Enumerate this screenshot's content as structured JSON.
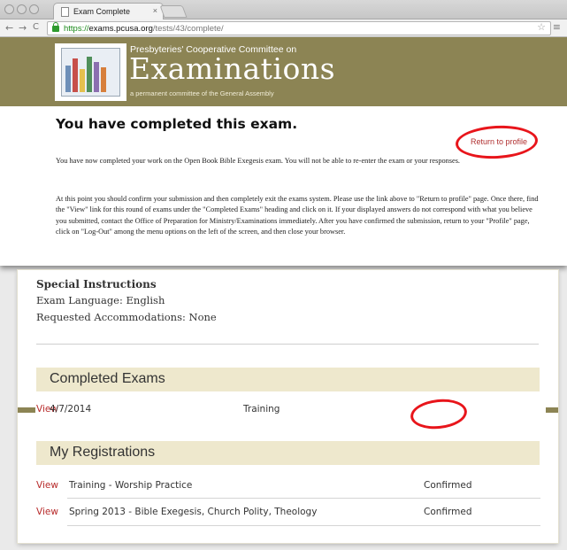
{
  "browser": {
    "tab_title": "Exam Complete",
    "tab_close": "×",
    "url_scheme": "https://",
    "url_domain": "exams.pcusa.org",
    "url_path": "/tests/43/complete/"
  },
  "banner": {
    "subtitle": "Presbyteries' Cooperative Committee on",
    "title": "Examinations",
    "tagline": "a permanent committee of the General Assembly"
  },
  "page": {
    "heading": "You have completed this exam.",
    "return_link": "Return to profile",
    "paragraph_1": "You have now completed your work on the Open Book Bible Exegesis exam. You will not be able to re-enter the exam or your responses.",
    "paragraph_2": "At this point you should confirm your submission and then completely exit the exams system. Please use the link above to \"Return to profile\" page. Once there, find the \"View\" link for this round of exams under the \"Completed Exams\" heading and click on it. If your displayed answers do not correspond with what you believe you submitted, contact the Office of Preparation for Ministry/Examinations immediately. After you have confirmed the submission, return to your \"Profile\" page, click on \"Log-Out\" among the menu options on the left of the screen, and then close your browser."
  },
  "profile": {
    "special_instructions": "Special Instructions",
    "exam_language": "Exam Language: English",
    "accommodations": "Requested Accommodations: None",
    "completed_heading": "Completed Exams",
    "completed": [
      {
        "date": "4/7/2014",
        "name": "Training",
        "action": "View"
      }
    ],
    "registrations_heading": "My Registrations",
    "registrations": [
      {
        "name": "Training - Worship Practice",
        "status": "Confirmed",
        "action": "View"
      },
      {
        "name": "Spring 2013 - Bible Exegesis, Church Polity, Theology",
        "status": "Confirmed",
        "action": "View"
      }
    ]
  },
  "colors": {
    "banner": "#8c8454",
    "section_header": "#eee8cd",
    "link": "#b72a2a",
    "highlight_circle": "#e8151b"
  }
}
